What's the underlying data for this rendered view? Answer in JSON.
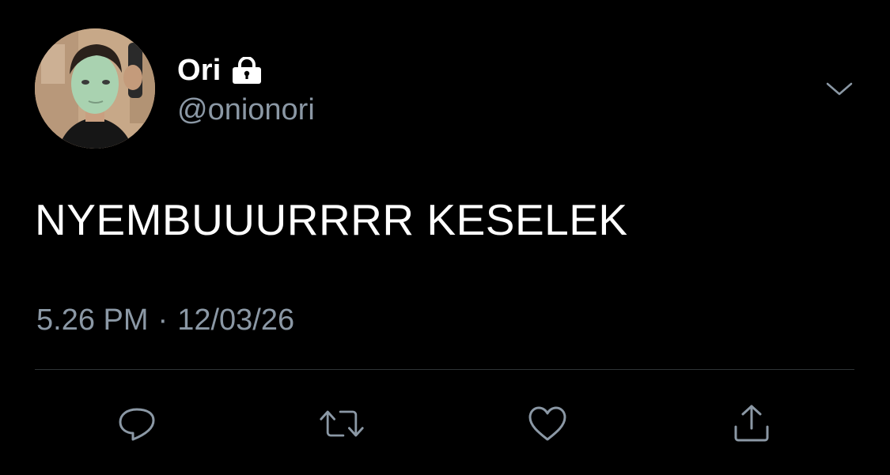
{
  "author": {
    "display_name": "Ori",
    "username": "@onionori",
    "protected": true
  },
  "tweet": {
    "text": "NYEMBUUURRRR KESELEK",
    "time": "5.26 PM",
    "separator": "·",
    "date": "12/03/26"
  },
  "icons": {
    "lock": "lock-icon",
    "caret": "chevron-down-icon",
    "reply": "reply-icon",
    "retweet": "retweet-icon",
    "like": "heart-icon",
    "share": "share-icon"
  },
  "colors": {
    "background": "#000000",
    "text": "#ffffff",
    "secondary": "#8b98a5",
    "divider": "#2f3336"
  }
}
